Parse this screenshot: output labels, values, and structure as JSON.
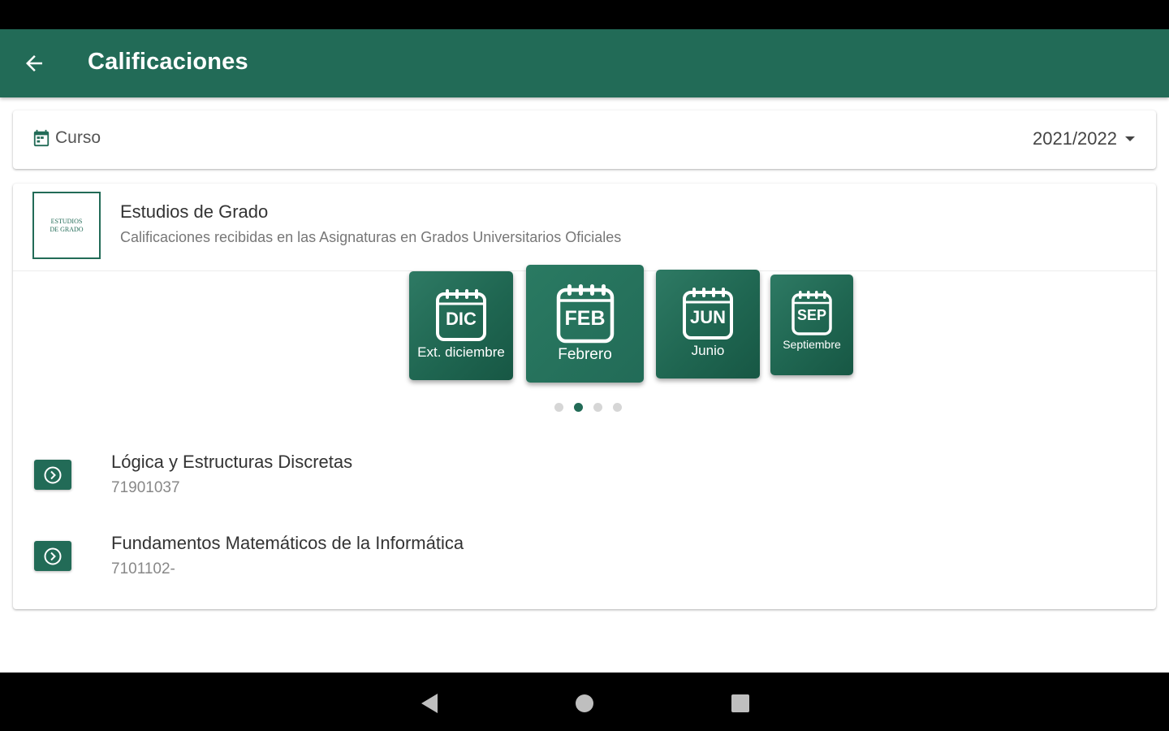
{
  "app_bar": {
    "title": "Calificaciones",
    "color": "#226b57",
    "back_icon": "arrow-left-icon"
  },
  "curso": {
    "label": "Curso",
    "icon": "calendar-icon",
    "selected": "2021/2022"
  },
  "grado": {
    "logo_lines": [
      "ESTUDIOS",
      "DE GRADO"
    ],
    "title": "Estudios de Grado",
    "subtitle": "Calificaciones recibidas en las Asignaturas en Grados Universitarios Oficiales"
  },
  "convocatorias": [
    {
      "abbr": "DIC",
      "label": "Ext. diciembre"
    },
    {
      "abbr": "FEB",
      "label": "Febrero"
    },
    {
      "abbr": "JUN",
      "label": "Junio"
    },
    {
      "abbr": "SEP",
      "label": "Septiembre"
    }
  ],
  "carousel": {
    "active_index": 1,
    "page_count": 4
  },
  "subjects": [
    {
      "name": "Lógica y Estructuras Discretas",
      "code": "71901037"
    },
    {
      "name": "Fundamentos Matemáticos de la Informática",
      "code": "7101102-"
    }
  ],
  "nav": {
    "back": "triangle-back-icon",
    "home": "circle-home-icon",
    "recents": "square-recents-icon"
  }
}
